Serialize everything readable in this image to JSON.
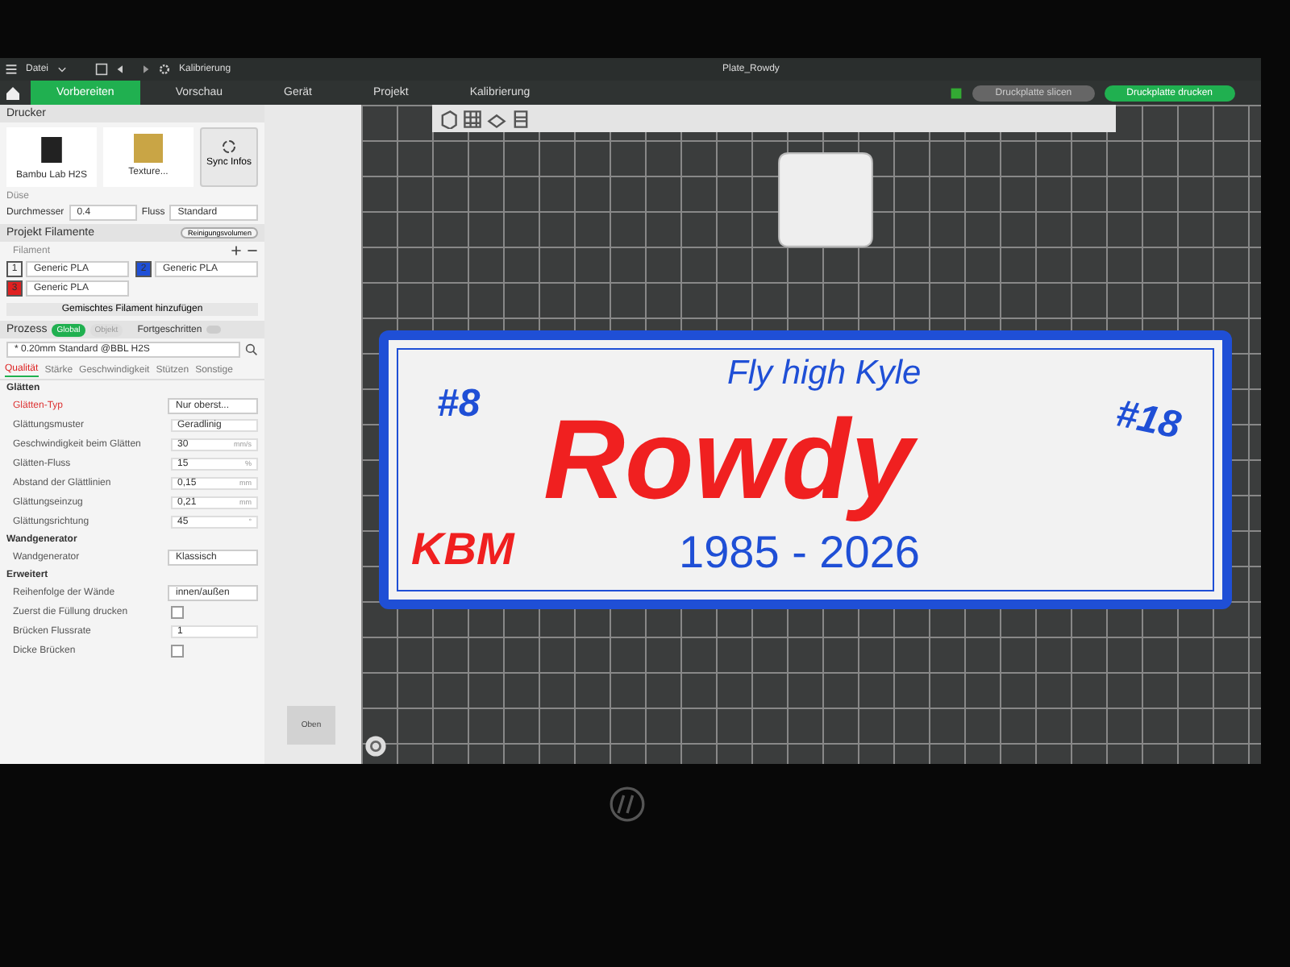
{
  "title_bar": {
    "menu": "Datei",
    "calibration": "Kalibrierung",
    "title": "Plate_Rowdy",
    "slice_button": "Druckplatte slicen",
    "print_button": "Druckplatte drucken"
  },
  "tabs": [
    {
      "label": "Vorbereiten",
      "selected": true
    },
    {
      "label": "Vorschau",
      "selected": false
    },
    {
      "label": "Gerät",
      "selected": false
    },
    {
      "label": "Projekt",
      "selected": false
    },
    {
      "label": "Kalibrierung",
      "selected": false
    }
  ],
  "printer": {
    "title": "Drucker",
    "printer_name": "Bambu Lab H2S",
    "plate": "Texture...",
    "sync_button": "Sync Infos",
    "nozzle_label": "Düse",
    "diameter_label": "Durchmesser",
    "diameter": "0.4",
    "flow_label": "Fluss",
    "flow": "Standard"
  },
  "filaments": {
    "title": "Projekt Filamente",
    "purge_button": "Reinigungsvolumen",
    "filament_label": "Filament",
    "items": [
      {
        "number": "1",
        "name": "Generic PLA",
        "color": "#f4f4f4"
      },
      {
        "number": "2",
        "name": "Generic PLA",
        "color": "#1f4fd6"
      },
      {
        "number": "3",
        "name": "Generic PLA",
        "color": "#e02020"
      }
    ],
    "add_button": "Gemischtes Filament hinzufügen"
  },
  "process": {
    "title": "Prozess",
    "scopes": [
      {
        "label": "Global",
        "selected": true
      },
      {
        "label": "Objekt",
        "selected": false
      }
    ],
    "advanced_label": "Fortgeschritten",
    "advanced_on": false,
    "preset": "* 0.20mm Standard @BBL H2S",
    "tabs": [
      {
        "label": "Qualität",
        "selected": true
      },
      {
        "label": "Stärke",
        "selected": false
      },
      {
        "label": "Geschwindigkeit",
        "selected": false
      },
      {
        "label": "Stützen",
        "selected": false
      },
      {
        "label": "Sonstige",
        "selected": false
      }
    ],
    "sections": [
      {
        "title": "Glätten",
        "rows": [
          {
            "kind": "dropdown",
            "label": "Glätten-Typ",
            "value": "Nur oberst...",
            "modified": true
          },
          {
            "kind": "pattern",
            "label": "Glättungsmuster",
            "value": "Geradlinig",
            "modified": false
          },
          {
            "kind": "number",
            "label": "Geschwindigkeit beim Glätten",
            "value": "30",
            "unit": "mm/s",
            "modified": false
          },
          {
            "kind": "number",
            "label": "Glätten-Fluss",
            "value": "15",
            "unit": "%",
            "modified": false
          },
          {
            "kind": "number",
            "label": "Abstand der Glättlinien",
            "value": "0,15",
            "unit": "mm",
            "modified": false
          },
          {
            "kind": "number",
            "label": "Glättungseinzug",
            "value": "0,21",
            "unit": "mm",
            "modified": false
          },
          {
            "kind": "number",
            "label": "Glättungsrichtung",
            "value": "45",
            "unit": "°",
            "modified": false
          }
        ]
      },
      {
        "title": "Wandgenerator",
        "rows": [
          {
            "kind": "dropdown",
            "label": "Wandgenerator",
            "value": "Klassisch",
            "modified": false
          }
        ]
      },
      {
        "title": "Erweitert",
        "rows": [
          {
            "kind": "dropdown",
            "label": "Reihenfolge der Wände",
            "value": "innen/außen",
            "modified": false
          },
          {
            "kind": "checkbox",
            "label": "Zuerst die Füllung drucken",
            "checked": false,
            "modified": false
          },
          {
            "kind": "number",
            "label": "Brücken Flussrate",
            "value": "1",
            "modified": false
          },
          {
            "kind": "checkbox",
            "label": "Dicke Brücken",
            "checked": false,
            "modified": false
          }
        ]
      }
    ]
  },
  "canvas": {
    "view_cube": "Oben",
    "sign": {
      "subtitle": "Fly high Kyle",
      "left_number": "#8",
      "right_number": "#18",
      "name": "Rowdy",
      "logo": "KBM",
      "years": "1985 - 2026"
    }
  }
}
